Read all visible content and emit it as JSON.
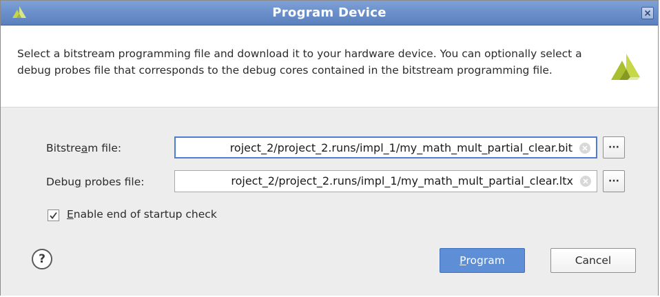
{
  "window": {
    "title": "Program Device",
    "title_color": "#ffffff",
    "titlebar_color": "#6a8fca"
  },
  "header": {
    "description": "Select a bitstream programming file and download it to your hardware device. You can optionally select a debug probes file that corresponds to the debug cores contained in the bitstream programming file.",
    "logo_icon": "vivado-logo-icon",
    "logo_color": "#a2b92c"
  },
  "form": {
    "bitstream": {
      "label_pre": "Bitstre",
      "label_mnemonic": "a",
      "label_post": "m file:",
      "value": "roject_2/project_2.runs/impl_1/my_math_mult_partial_clear.bit"
    },
    "debug_probes": {
      "label_pre": "Debu",
      "label_mnemonic": "g",
      "label_post": " probes file:",
      "value": "roject_2/project_2.runs/impl_1/my_math_mult_partial_clear.ltx"
    },
    "browse_label": "···",
    "startup_check": {
      "checked": true,
      "label_mnemonic": "E",
      "label_rest": "nable end of startup check"
    }
  },
  "footer": {
    "help_label": "?",
    "program_mnemonic": "P",
    "program_rest": "rogram",
    "cancel_label": "Cancel",
    "accent_color": "#5d8ed6"
  }
}
